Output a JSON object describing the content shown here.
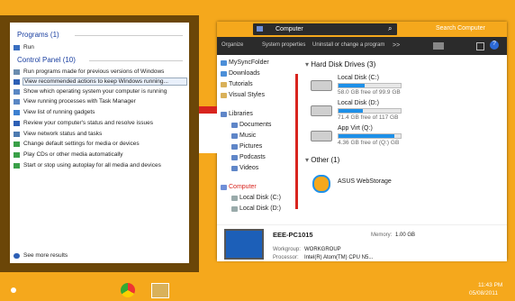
{
  "colors": {
    "desktop": "#f5a81c",
    "startmenu": "#6b4608",
    "accent": "#1e90e8"
  },
  "start": {
    "programs_heading": "Programs (1)",
    "programs": [
      {
        "label": "Run",
        "icon": "run-icon"
      }
    ],
    "cp_heading": "Control Panel (10)",
    "cp": [
      {
        "label": "Run programs made for previous versions of Windows",
        "icon": "compat-icon"
      },
      {
        "label": "View recommended actions to keep Windows running...",
        "icon": "flag-icon"
      },
      {
        "label": "Show which operating system your computer is running",
        "icon": "computer-icon"
      },
      {
        "label": "View running processes with Task Manager",
        "icon": "computer-icon"
      },
      {
        "label": "View list of running gadgets",
        "icon": "gadget-icon"
      },
      {
        "label": "Review your computer's status and resolve issues",
        "icon": "flag-icon"
      },
      {
        "label": "View network status and tasks",
        "icon": "network-icon"
      },
      {
        "label": "Change default settings for media or devices",
        "icon": "autoplay-icon"
      },
      {
        "label": "Play CDs or other media automatically",
        "icon": "autoplay-icon"
      },
      {
        "label": "Start or stop using autoplay for all media and devices",
        "icon": "autoplay-icon"
      }
    ],
    "see_more": "See more results"
  },
  "explorer": {
    "breadcrumb": "Computer",
    "search_placeholder": "Search Computer",
    "toolbar": [
      "Organize",
      "System properties",
      "Uninstall or change a program",
      ">>"
    ],
    "nav_favs": [
      "MySyncFolder",
      "Downloads",
      "Tutorials",
      "Visual Styles"
    ],
    "nav_libs_head": "Libraries",
    "nav_libs": [
      "Documents",
      "Music",
      "Pictures",
      "Podcasts",
      "Videos"
    ],
    "nav_comp_head": "Computer",
    "nav_comp": [
      "Local Disk (C:)",
      "Local Disk (D:)"
    ],
    "hdd_heading": "Hard Disk Drives (3)",
    "drives": [
      {
        "name": "Local Disk (C:)",
        "size": "58.0 GB free of 99.9 GB",
        "used": 0.42
      },
      {
        "name": "Local Disk (D:)",
        "size": "71.4 GB free of 117 GB",
        "used": 0.39
      },
      {
        "name": "App Virt (Q:)",
        "size": "4.36 GB free of (Q:) GB",
        "used": 0.9
      }
    ],
    "other_heading": "Other (1)",
    "other_item": "ASUS WebStorage",
    "pc_name": "EEE-PC1015",
    "memory_label": "Memory:",
    "memory_value": "1.00 GB",
    "workgroup_label": "Workgroup:",
    "workgroup_value": "WORKGROUP",
    "processor_label": "Processor:",
    "processor_value": "Intel(R) Atom(TM) CPU N5..."
  },
  "clock": {
    "time": "11:43 PM",
    "date": "05/08/2011"
  }
}
